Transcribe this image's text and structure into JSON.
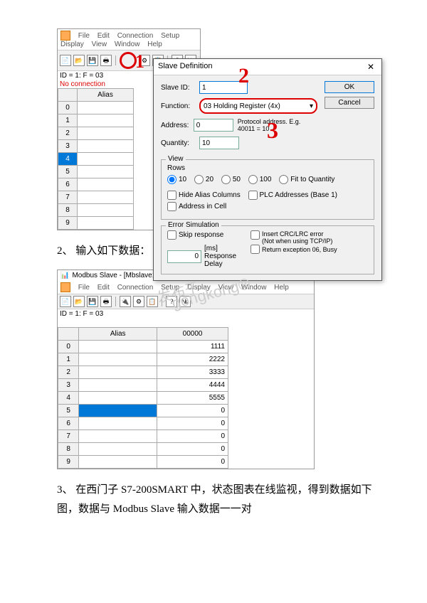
{
  "menu": {
    "file": "File",
    "edit": "Edit",
    "connection": "Connection",
    "setup": "Setup",
    "display": "Display",
    "view": "View",
    "window": "Window",
    "help": "Help"
  },
  "app1": {
    "status": "ID = 1: F = 03",
    "nocon": "No connection",
    "grid_header": "Alias",
    "rows": [
      "0",
      "1",
      "2",
      "3",
      "4",
      "5",
      "6",
      "7",
      "8",
      "9"
    ]
  },
  "dialog": {
    "title": "Slave Definition",
    "close": "✕",
    "slave_id_lbl": "Slave ID:",
    "slave_id": "1",
    "function_lbl": "Function:",
    "function": "03 Holding Register (4x)",
    "address_lbl": "Address:",
    "address": "0",
    "proto": "Protocol address. E.g. 40011 = 10",
    "quantity_lbl": "Quantity:",
    "quantity": "10",
    "ok": "OK",
    "cancel": "Cancel",
    "view": "View",
    "rows": "Rows",
    "r10": "10",
    "r20": "20",
    "r50": "50",
    "r100": "100",
    "rfit": "Fit to Quantity",
    "hide": "Hide Alias Columns",
    "plc": "PLC Addresses (Base 1)",
    "addr_cell": "Address in Cell",
    "err": "Error Simulation",
    "skip": "Skip response",
    "delay": "0",
    "delay_lbl": "[ms] Response Delay",
    "crc": "Insert CRC/LRC error\n(Not when using TCP/IP)",
    "ret06": "Return exception 06, Busy"
  },
  "para2": "2、 输入如下数据：",
  "app2": {
    "title": "Modbus Slave - [Mbslave1]",
    "status": "ID = 1: F = 03",
    "h_alias": "Alias",
    "h_val": "00000",
    "rows": [
      {
        "i": "0",
        "v": "1111"
      },
      {
        "i": "1",
        "v": "2222"
      },
      {
        "i": "2",
        "v": "3333"
      },
      {
        "i": "3",
        "v": "4444"
      },
      {
        "i": "4",
        "v": "5555"
      },
      {
        "i": "5",
        "v": "0"
      },
      {
        "i": "6",
        "v": "0"
      },
      {
        "i": "7",
        "v": "0"
      },
      {
        "i": "8",
        "v": "0"
      },
      {
        "i": "9",
        "v": "0"
      }
    ]
  },
  "para3": "3、 在西门子 S7-200SMART 中，状态图表在线监视，得到数据如下图，数据与 Modbus Slave 输入数据一一对",
  "wm1": "发布于",
  "wm2": "gongkong®",
  "anno1": "1",
  "anno2": "2",
  "anno3": "3"
}
